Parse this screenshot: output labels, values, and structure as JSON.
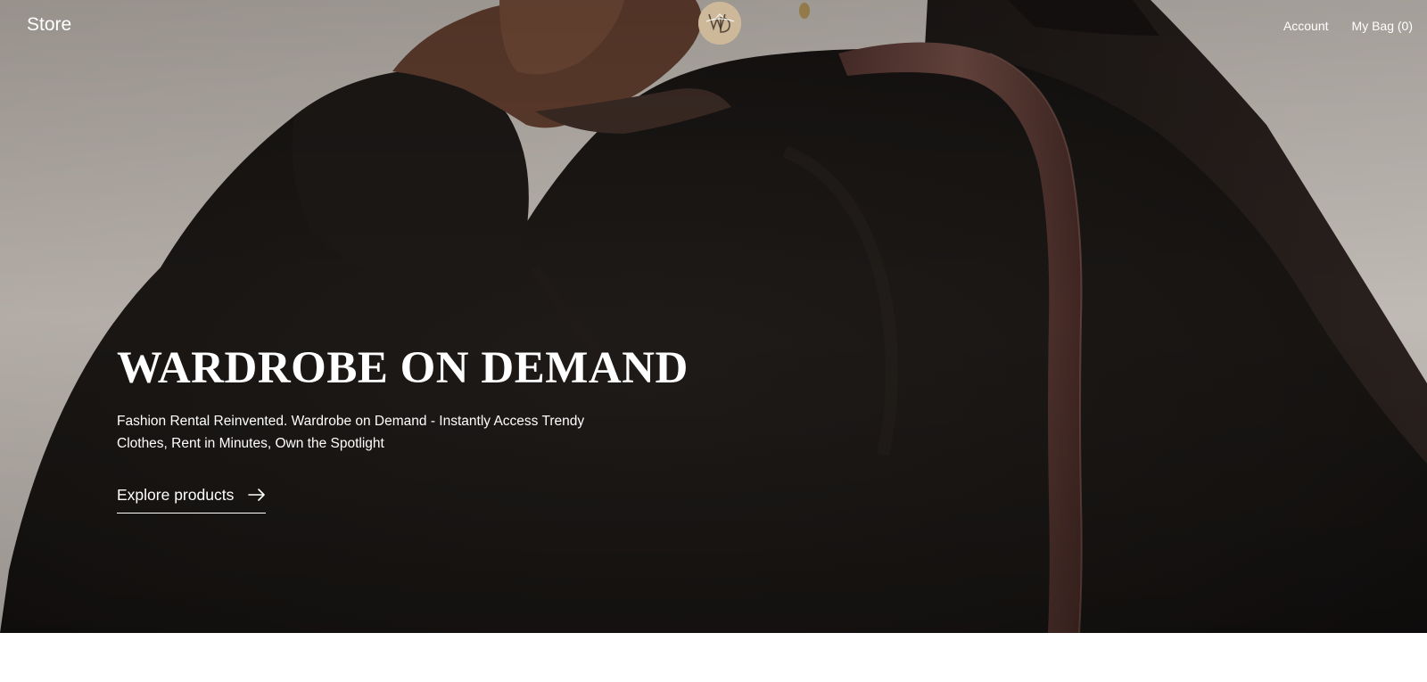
{
  "nav": {
    "store_label": "Store",
    "logo_alt": "WD",
    "account_label": "Account",
    "bag_label": "My Bag (0)"
  },
  "hero": {
    "title": "WARDROBE ON DEMAND",
    "subtitle": "Fashion Rental Reinvented. Wardrobe on Demand - Instantly Access Trendy Clothes, Rent in Minutes, Own the Spotlight",
    "cta_label": "Explore products",
    "cta_icon": "arrow-right-icon"
  },
  "colors": {
    "wall_background": "#b3aca6",
    "coat": "#1b1816",
    "strap": "#5b3a34",
    "logo_badge": "#cdb99a",
    "text": "#ffffff",
    "page_background": "#ffffff"
  }
}
